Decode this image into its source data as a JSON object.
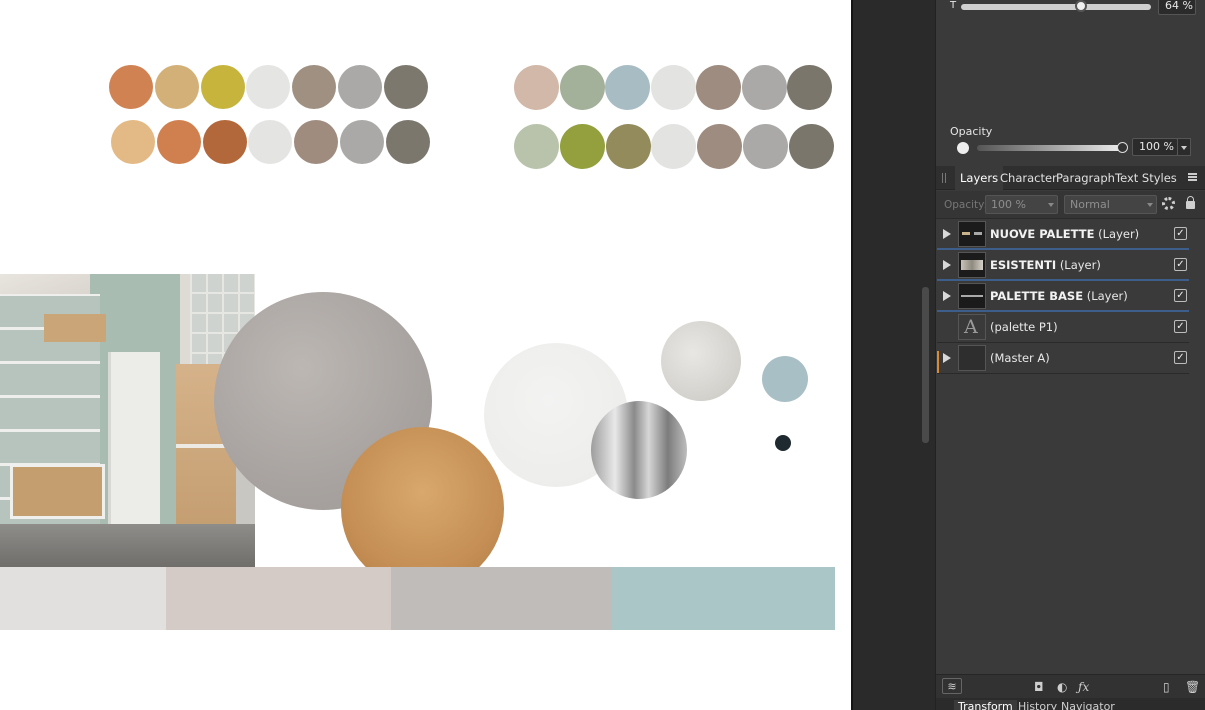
{
  "top_slider": {
    "label": "T",
    "value": "64 %",
    "level": 0.64
  },
  "opacity": {
    "label": "Opacity",
    "value": "100 %",
    "level": 1.0
  },
  "tabs": [
    "Layers",
    "Character",
    "Paragraph",
    "Text Styles"
  ],
  "layer_options": {
    "opacity_label": "Opacity:",
    "opacity_value": "100 %",
    "blend_mode": "Normal"
  },
  "layers": [
    {
      "name": "NUOVE PALETTE",
      "type": "(Layer)",
      "expandable": true,
      "checked": true,
      "bold": true
    },
    {
      "name": "ESISTENTI",
      "type": "(Layer)",
      "expandable": true,
      "checked": true,
      "bold": true
    },
    {
      "name": "PALETTE BASE",
      "type": "(Layer)",
      "expandable": true,
      "checked": true,
      "bold": true
    },
    {
      "name": "",
      "type": "(palette P1)",
      "expandable": false,
      "checked": true,
      "bold": false,
      "thumb_glyph": "A"
    },
    {
      "name": "",
      "type": "(Master A)",
      "expandable": true,
      "checked": true,
      "bold": false
    }
  ],
  "bottom_tabs": [
    "Transform",
    "History",
    "Navigator"
  ],
  "palette_colors": {
    "row1_left": [
      "#d08252",
      "#d3b077",
      "#c6b43d",
      "#e5e5e4",
      "#a09082",
      "#aaa9a7",
      "#7c786e"
    ],
    "row2_left": [
      "#e3ba85",
      "#d0804f",
      "#b2683a",
      "#e4e4e3",
      "#9f8c7f",
      "#aaa9a7",
      "#7b776d"
    ],
    "row1_right": [
      "#d2b8a8",
      "#a3b09a",
      "#a8bcc4",
      "#e3e3e2",
      "#9f8c80",
      "#aaa9a7",
      "#7a766c"
    ],
    "row2_right": [
      "#b9c3ac",
      "#93a03d",
      "#938b5c",
      "#e3e3e2",
      "#9f8c80",
      "#aaa9a7",
      "#7a766c"
    ],
    "strips": [
      "#e1e0de",
      "#d4cbc6",
      "#bfbcba",
      "#abc6c6"
    ]
  }
}
